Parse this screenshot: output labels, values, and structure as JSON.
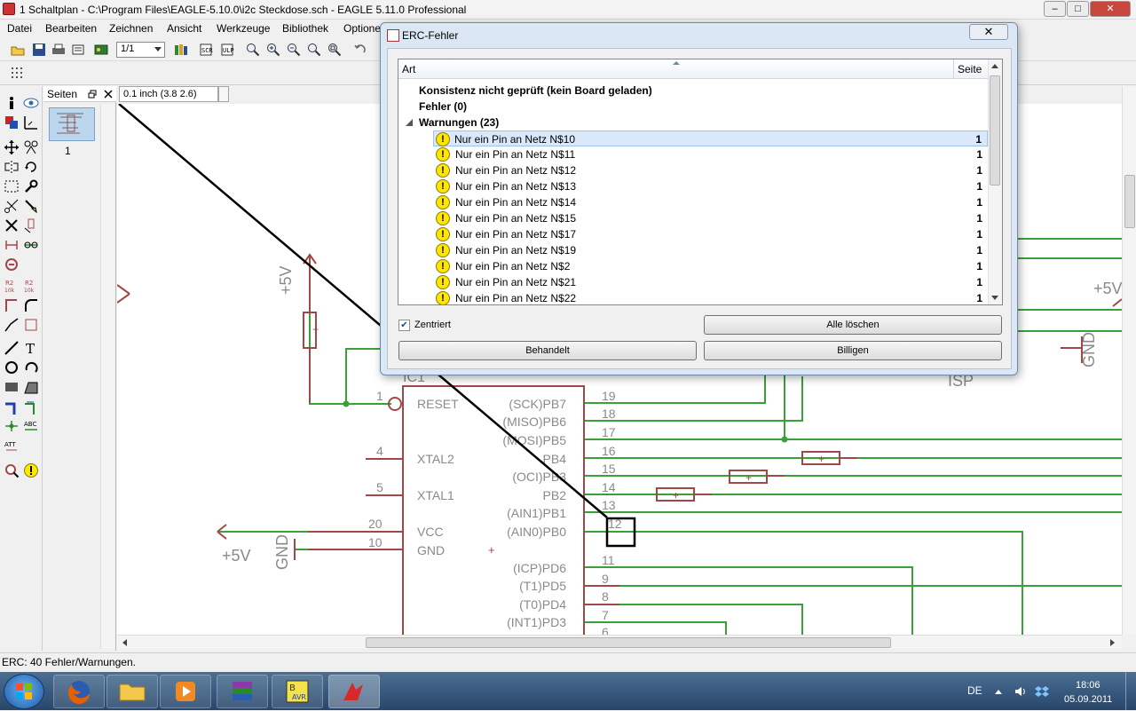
{
  "window": {
    "title": "1 Schaltplan - C:\\Program Files\\EAGLE-5.10.0\\i2c Steckdose.sch - EAGLE 5.11.0 Professional",
    "minimize": "‒",
    "maximize": "□",
    "close": "✕"
  },
  "menu": [
    "Datei",
    "Bearbeiten",
    "Zeichnen",
    "Ansicht",
    "Werkzeuge",
    "Bibliothek",
    "Optionen"
  ],
  "toolbar": {
    "zoom_select": "1/1"
  },
  "pages_panel": {
    "title": "Seiten",
    "page_label": "1"
  },
  "coordinate": "0.1 inch (3.8 2.6)",
  "schematic": {
    "labels": {
      "plus5v_a": "+5V",
      "plus5v_b": "+5V",
      "plus5v_c": "+5V",
      "gnd_a": "GND",
      "gnd_b": "GND",
      "isp": "ISP",
      "ic1": "IC1",
      "plus": "+"
    },
    "left_pins": [
      {
        "num": "1",
        "name": "RESET"
      },
      {
        "num": "4",
        "name": "XTAL2"
      },
      {
        "num": "5",
        "name": "XTAL1"
      },
      {
        "num": "20",
        "name": "VCC"
      },
      {
        "num": "10",
        "name": "GND"
      }
    ],
    "right_pins": [
      {
        "num": "19",
        "name": "(SCK)PB7"
      },
      {
        "num": "18",
        "name": "(MISO)PB6"
      },
      {
        "num": "17",
        "name": "(MOSI)PB5"
      },
      {
        "num": "16",
        "name": "PB4"
      },
      {
        "num": "15",
        "name": "(OCI)PB3"
      },
      {
        "num": "14",
        "name": "PB2"
      },
      {
        "num": "13",
        "name": "(AIN1)PB1"
      },
      {
        "num": "12",
        "name": "(AIN0)PB0"
      },
      {
        "num": "11",
        "name": "(ICP)PD6"
      },
      {
        "num": "9",
        "name": "(T1)PD5"
      },
      {
        "num": "8",
        "name": "(T0)PD4"
      },
      {
        "num": "7",
        "name": "(INT1)PD3"
      },
      {
        "num": "6",
        "name": ""
      }
    ]
  },
  "status": "ERC: 40 Fehler/Warnungen.",
  "dialog": {
    "title": "ERC-Fehler",
    "col_art": "Art",
    "col_seite": "Seite",
    "line_consistency": "Konsistenz nicht geprüft (kein Board geladen)",
    "line_errors": "Fehler (0)",
    "line_warnings": "Warnungen (23)",
    "warning_icon": "!",
    "warnings": [
      {
        "text": "Nur ein Pin an Netz N$10",
        "page": "1"
      },
      {
        "text": "Nur ein Pin an Netz N$11",
        "page": "1"
      },
      {
        "text": "Nur ein Pin an Netz N$12",
        "page": "1"
      },
      {
        "text": "Nur ein Pin an Netz N$13",
        "page": "1"
      },
      {
        "text": "Nur ein Pin an Netz N$14",
        "page": "1"
      },
      {
        "text": "Nur ein Pin an Netz N$15",
        "page": "1"
      },
      {
        "text": "Nur ein Pin an Netz N$17",
        "page": "1"
      },
      {
        "text": "Nur ein Pin an Netz N$19",
        "page": "1"
      },
      {
        "text": "Nur ein Pin an Netz N$2",
        "page": "1"
      },
      {
        "text": "Nur ein Pin an Netz N$21",
        "page": "1"
      },
      {
        "text": "Nur ein Pin an Netz N$22",
        "page": "1"
      }
    ],
    "centered_label": "Zentriert",
    "btn_delete_all": "Alle löschen",
    "btn_handled": "Behandelt",
    "btn_approve": "Billigen"
  },
  "taskbar": {
    "language": "DE",
    "time": "18:06",
    "date": "05.09.2011"
  },
  "colors": {
    "net": "#3aa03a",
    "symbol": "#a04848",
    "dialog_frame": "#dbe7f5",
    "selection": "#d9e9fb"
  }
}
